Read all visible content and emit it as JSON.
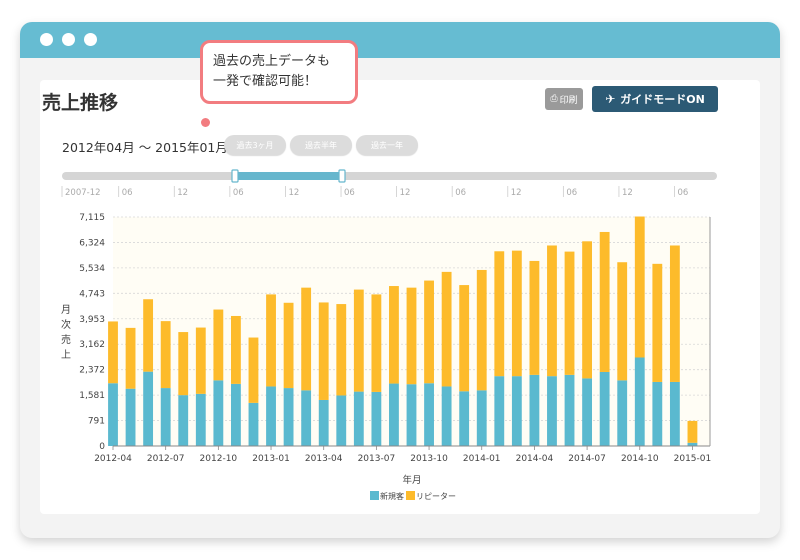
{
  "window": {
    "title_dots": [
      "dot-1",
      "dot-2",
      "dot-3"
    ]
  },
  "page": {
    "title": "売上推移"
  },
  "toolbar": {
    "print_label": "印刷",
    "guide_label": "ガイドモードON",
    "print_icon": "printer-icon",
    "guide_icon": "airplane-icon"
  },
  "tooltip": {
    "line1": "過去の売上データも",
    "line2": "一発で確認可能！"
  },
  "range": {
    "label": "2012年04月 ～ 2015年01月",
    "buttons": [
      "過去3ヶ月",
      "過去半年",
      "過去一年"
    ]
  },
  "navigator": {
    "labels": [
      "2007-12",
      "06",
      "12",
      "06",
      "12",
      "06",
      "12",
      "06",
      "12",
      "06",
      "12",
      "06"
    ],
    "selected_from": "2012-04",
    "selected_to": "2015-01"
  },
  "colors": {
    "new_customer": "#5ab9cf",
    "repeater": "#fdbb2b",
    "guide_button": "#2c5a75",
    "titlebar": "#66bcd2",
    "tooltip_border": "#f27c80"
  },
  "chart_data": {
    "type": "bar",
    "stacked": true,
    "title": "",
    "xlabel": "年月",
    "ylabel": "月次売上",
    "ylim": [
      0,
      7115
    ],
    "y_ticks": [
      "0",
      "791",
      "1,581",
      "2,372",
      "3,162",
      "3,953",
      "4,743",
      "5,534",
      "6,324",
      "7,115"
    ],
    "x_tick_labels": [
      "2012-04",
      "2012-07",
      "2012-10",
      "2013-01",
      "2013-04",
      "2013-07",
      "2013-10",
      "2014-01",
      "2014-04",
      "2014-07",
      "2014-10",
      "2015-01"
    ],
    "categories": [
      "2012-04",
      "2012-05",
      "2012-06",
      "2012-07",
      "2012-08",
      "2012-09",
      "2012-10",
      "2012-11",
      "2012-12",
      "2013-01",
      "2013-02",
      "2013-03",
      "2013-04",
      "2013-05",
      "2013-06",
      "2013-07",
      "2013-08",
      "2013-09",
      "2013-10",
      "2013-11",
      "2013-12",
      "2014-01",
      "2014-02",
      "2014-03",
      "2014-04",
      "2014-05",
      "2014-06",
      "2014-07",
      "2014-08",
      "2014-09",
      "2014-10",
      "2014-11",
      "2014-12",
      "2015-01"
    ],
    "series": [
      {
        "name": "新規客",
        "values": [
          1950,
          1780,
          2310,
          1800,
          1580,
          1620,
          2040,
          1930,
          1340,
          1850,
          1800,
          1730,
          1430,
          1570,
          1690,
          1680,
          1940,
          1920,
          1950,
          1850,
          1700,
          1730,
          2170,
          2170,
          2210,
          2170,
          2210,
          2100,
          2300,
          2040,
          2750,
          1990,
          1990,
          100
        ]
      },
      {
        "name": "リピーター",
        "values": [
          1920,
          1890,
          2250,
          2080,
          1960,
          2060,
          2200,
          2110,
          2030,
          2860,
          2650,
          3190,
          3030,
          2840,
          3170,
          3030,
          3030,
          3000,
          3190,
          3560,
          3300,
          3740,
          3880,
          3900,
          3540,
          4060,
          3830,
          4260,
          4350,
          3670,
          4380,
          3670,
          4240,
          680
        ]
      }
    ],
    "legend": [
      "新規客",
      "リピーター"
    ],
    "legend_position": "bottom-center",
    "grid": true
  }
}
